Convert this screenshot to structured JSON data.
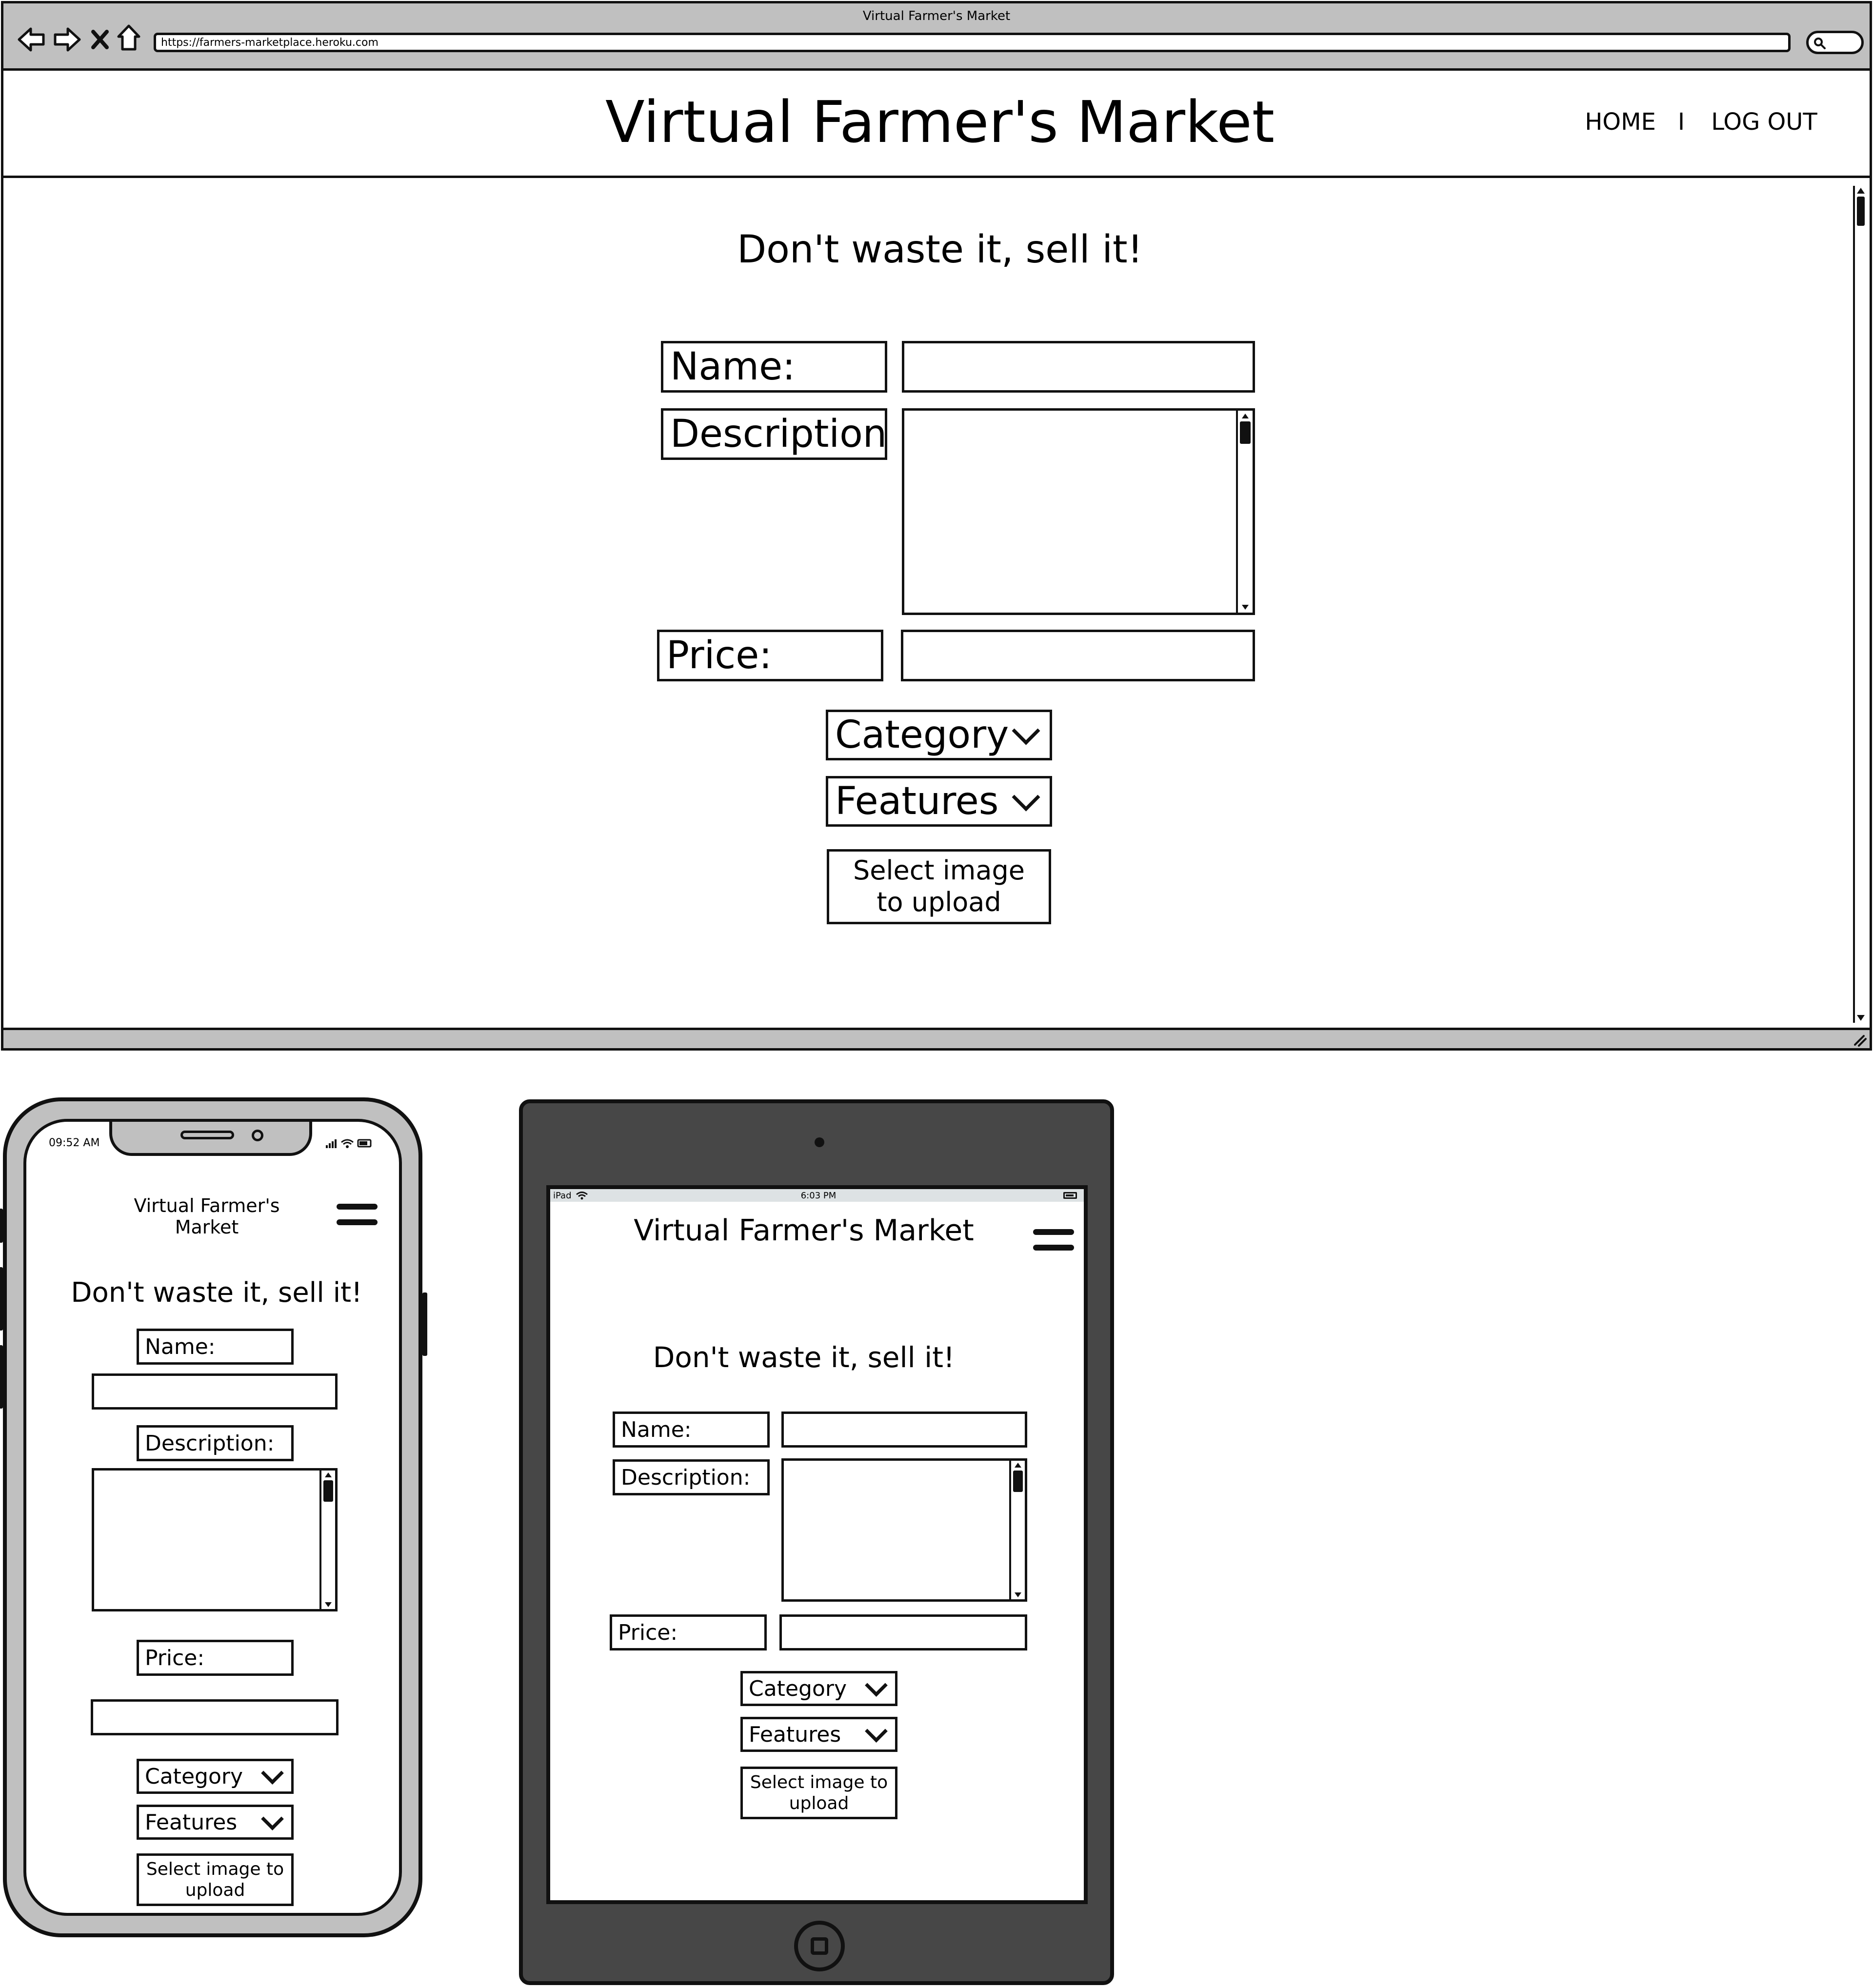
{
  "browser": {
    "title": "Virtual Farmer's Market",
    "url": "https://farmers-marketplace.heroku.com",
    "icons": [
      "back-arrow-icon",
      "forward-arrow-icon",
      "close-icon",
      "home-icon",
      "search-icon"
    ]
  },
  "site": {
    "title": "Virtual Farmer's Market",
    "nav": {
      "home": "HOME",
      "separator": "I",
      "logout": "LOG OUT"
    }
  },
  "form": {
    "heading": "Don't waste it, sell it!",
    "name_label": "Name:",
    "description_label": "Description:",
    "price_label": "Price:",
    "category": "Category",
    "features": "Features",
    "upload": "Select image to upload"
  },
  "phone": {
    "time": "09:52 AM"
  },
  "tablet": {
    "carrier": "iPad",
    "time": "6:03 PM"
  },
  "colors": {
    "frame_gray": "#c0c0c0",
    "tablet_body": "#474747",
    "tablet_status": "#dde2e4",
    "ink": "#111111"
  }
}
